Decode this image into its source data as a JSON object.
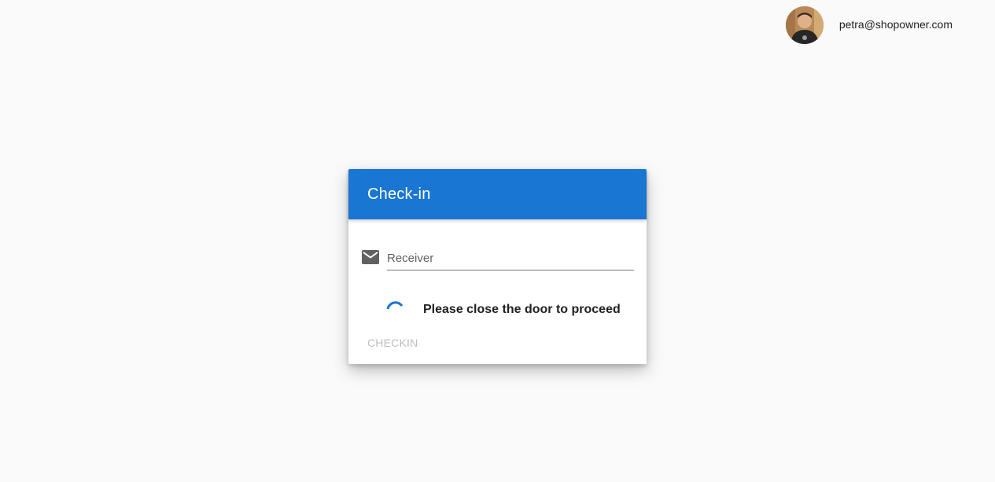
{
  "user": {
    "email": "petra@shopowner.com",
    "avatar_icon": "user-avatar"
  },
  "dialog": {
    "title": "Check-in",
    "receiver": {
      "icon": "mail-icon",
      "value": "",
      "placeholder": "Receiver"
    },
    "status": {
      "icon": "loading-spinner",
      "message": "Please close the door to proceed"
    },
    "checkin_button": {
      "label": "CHECKIN",
      "disabled": true
    }
  },
  "colors": {
    "background": "#fafafa",
    "header": "#1976d2",
    "spinner": "#1976d2",
    "disabled_text": "#bdbdbd",
    "icon": "#616161"
  }
}
